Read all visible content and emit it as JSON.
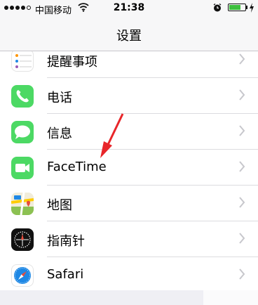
{
  "status_bar": {
    "signal_bars": 4,
    "signal_max": 5,
    "carrier": "中国移动",
    "wifi_icon": "wifi-icon",
    "time": "21:38",
    "alarm_icon": "alarm-clock-icon",
    "battery_level": 0.72,
    "battery_color": "#3dbf3d",
    "charging_icon": "lightning-bolt-icon"
  },
  "nav": {
    "title": "设置"
  },
  "rows": [
    {
      "label": "提醒事项",
      "icon": "reminders-icon"
    },
    {
      "label": "电话",
      "icon": "phone-icon",
      "color": "#4cd964"
    },
    {
      "label": "信息",
      "icon": "messages-icon",
      "color": "#4cd964"
    },
    {
      "label": "FaceTime",
      "icon": "facetime-icon",
      "color": "#4cd964"
    },
    {
      "label": "地图",
      "icon": "maps-icon"
    },
    {
      "label": "指南针",
      "icon": "compass-icon",
      "color": "#111111"
    },
    {
      "label": "Safari",
      "icon": "safari-icon",
      "color": "#1e88e5"
    }
  ],
  "annotation": {
    "icon": "red-arrow-icon",
    "color": "#e8262a"
  }
}
